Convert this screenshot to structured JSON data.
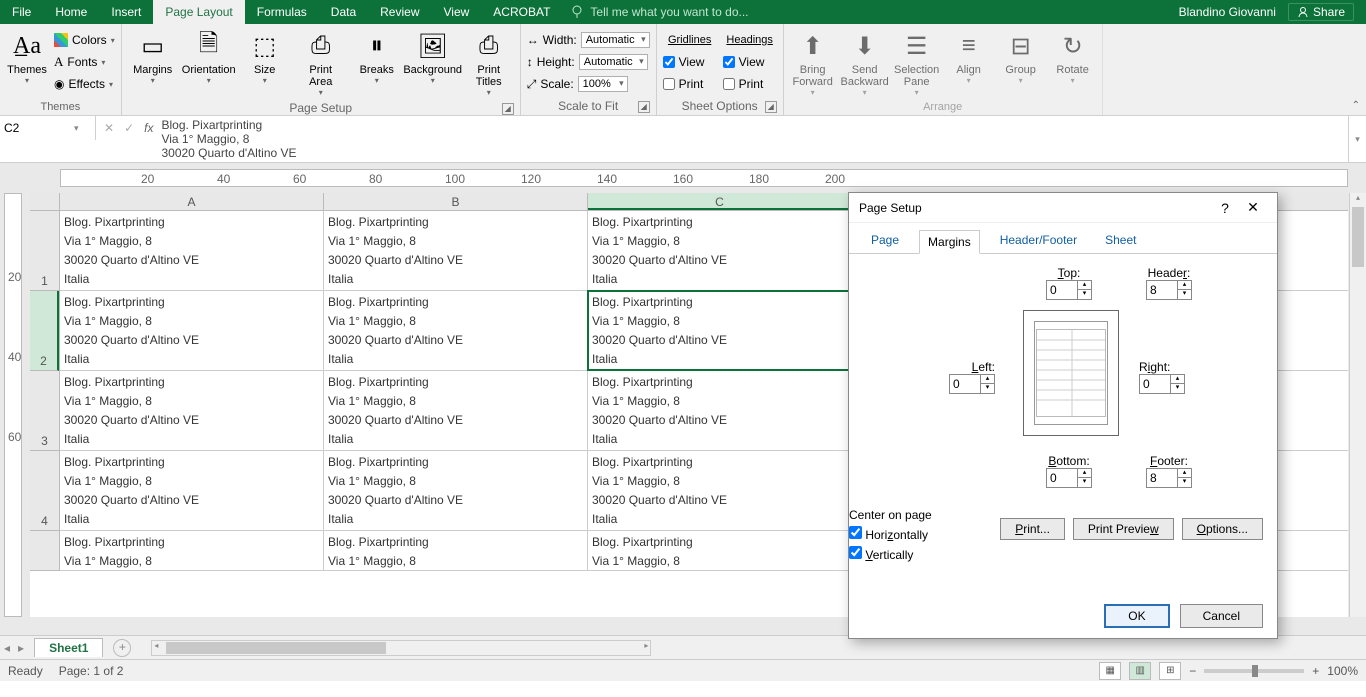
{
  "title_tabs": [
    "File",
    "Home",
    "Insert",
    "Page Layout",
    "Formulas",
    "Data",
    "Review",
    "View",
    "ACROBAT"
  ],
  "active_tab": "Page Layout",
  "tell_me": "Tell me what you want to do...",
  "user": "Blandino Giovanni",
  "share": "Share",
  "ribbon": {
    "themes": {
      "label": "Themes",
      "themes": "Themes",
      "colors": "Colors",
      "fonts": "Fonts",
      "effects": "Effects"
    },
    "page_setup": {
      "label": "Page Setup",
      "margins": "Margins",
      "orientation": "Orientation",
      "size": "Size",
      "print_area": "Print\nArea",
      "breaks": "Breaks",
      "background": "Background",
      "print_titles": "Print\nTitles"
    },
    "scale": {
      "label": "Scale to Fit",
      "width": "Width:",
      "height": "Height:",
      "scale": "Scale:",
      "width_val": "Automatic",
      "height_val": "Automatic",
      "scale_val": "100%"
    },
    "sheet_options": {
      "label": "Sheet Options",
      "gridlines": "Gridlines",
      "headings": "Headings",
      "view": "View",
      "print": "Print",
      "gl_view": true,
      "gl_print": false,
      "hd_view": true,
      "hd_print": false
    },
    "arrange": {
      "label": "Arrange",
      "bring_forward": "Bring\nForward",
      "send_backward": "Send\nBackward",
      "selection_pane": "Selection\nPane",
      "align": "Align",
      "group": "Group",
      "rotate": "Rotate"
    }
  },
  "namebox": "C2",
  "formula_lines": [
    "Blog. Pixartprinting",
    "Via 1° Maggio, 8",
    "30020 Quarto d'Altino VE"
  ],
  "columns": [
    "A",
    "B",
    "C"
  ],
  "ruler_h": [
    {
      "p": 80,
      "v": "20"
    },
    {
      "p": 156,
      "v": "40"
    },
    {
      "p": 232,
      "v": "60"
    },
    {
      "p": 308,
      "v": "80"
    },
    {
      "p": 384,
      "v": "100"
    },
    {
      "p": 460,
      "v": "120"
    },
    {
      "p": 536,
      "v": "140"
    },
    {
      "p": 612,
      "v": "160"
    },
    {
      "p": 688,
      "v": "180"
    },
    {
      "p": 764,
      "v": "200"
    }
  ],
  "ruler_v": [
    {
      "p": 76,
      "v": "20"
    },
    {
      "p": 156,
      "v": "40"
    },
    {
      "p": 236,
      "v": "60"
    }
  ],
  "row_nums": [
    "1",
    "2",
    "3",
    "4"
  ],
  "cell_text": "Blog. Pixartprinting\nVia 1° Maggio, 8\n30020 Quarto d'Altino VE\nItalia",
  "cell_partial": "Blog. Pixartprinting\nVia 1° Maggio, 8",
  "sheet_tab": "Sheet1",
  "status": {
    "ready": "Ready",
    "page": "Page: 1 of 2",
    "zoom": "100%"
  },
  "dialog": {
    "title": "Page Setup",
    "tabs": [
      "Page",
      "Margins",
      "Header/Footer",
      "Sheet"
    ],
    "active": "Margins",
    "labels": {
      "top": "Top:",
      "header": "Header:",
      "left": "Left:",
      "right": "Right:",
      "bottom": "Bottom:",
      "footer": "Footer:"
    },
    "vals": {
      "top": "0",
      "header": "8",
      "left": "0",
      "right": "0",
      "bottom": "0",
      "footer": "8"
    },
    "center_on": "Center on page",
    "horizontally": "Horizontally",
    "vertically": "Vertically",
    "hz_chk": true,
    "vt_chk": true,
    "print": "Print...",
    "preview": "Print Preview",
    "options": "Options...",
    "ok": "OK",
    "cancel": "Cancel"
  }
}
